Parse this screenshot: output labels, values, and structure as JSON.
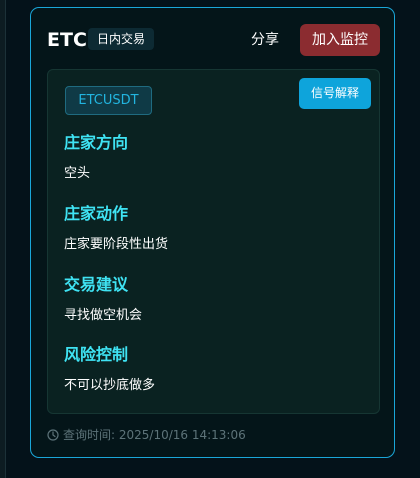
{
  "header": {
    "symbol": "ETC",
    "trade_type": "日内交易",
    "share_label": "分享",
    "watch_label": "加入监控"
  },
  "panel": {
    "ticker": "ETCUSDT",
    "explain_label": "信号解释",
    "sections": [
      {
        "title": "庄家方向",
        "value": "空头"
      },
      {
        "title": "庄家动作",
        "value": "庄家要阶段性出货"
      },
      {
        "title": "交易建议",
        "value": "寻找做空机会"
      },
      {
        "title": "风险控制",
        "value": "不可以抄底做多"
      }
    ]
  },
  "footer": {
    "query_time": "查询时间: 2025/10/16 14:13:06"
  },
  "colors": {
    "accent_border": "#1aa6d8",
    "section_title": "#3fe3f3",
    "watch_button": "#8b2c30",
    "explain_button": "#0ea4db",
    "ticker_text": "#22b5e0"
  },
  "icons": {
    "footer": "clock-icon"
  }
}
